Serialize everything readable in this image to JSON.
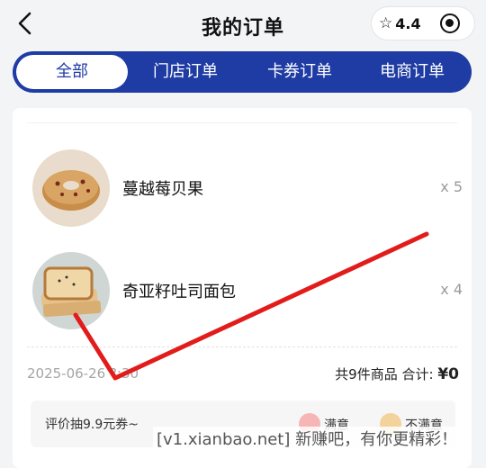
{
  "header": {
    "title": "我的订单",
    "rating": "4.4"
  },
  "tabs": [
    {
      "label": "全部",
      "active": true
    },
    {
      "label": "门店订单",
      "active": false
    },
    {
      "label": "卡券订单",
      "active": false
    },
    {
      "label": "电商订单",
      "active": false
    }
  ],
  "order": {
    "items": [
      {
        "name": "蔓越莓贝果",
        "qty": "x 5"
      },
      {
        "name": "奇亚籽吐司面包",
        "qty": "x 4"
      }
    ],
    "date": "2025-06-26 ?:30",
    "summary_count": "共9件商品 合计:",
    "summary_total": "¥0"
  },
  "evaluation": {
    "prompt": "评价抽9.9元券~",
    "satisfied_label": "满意",
    "unsatisfied_label": "不满意"
  },
  "watermark": "[v1.xianbao.net] 新赚吧，有你更精彩！",
  "colors": {
    "brand_blue": "#1e3ca3",
    "scribble_red": "#e21b1b"
  }
}
